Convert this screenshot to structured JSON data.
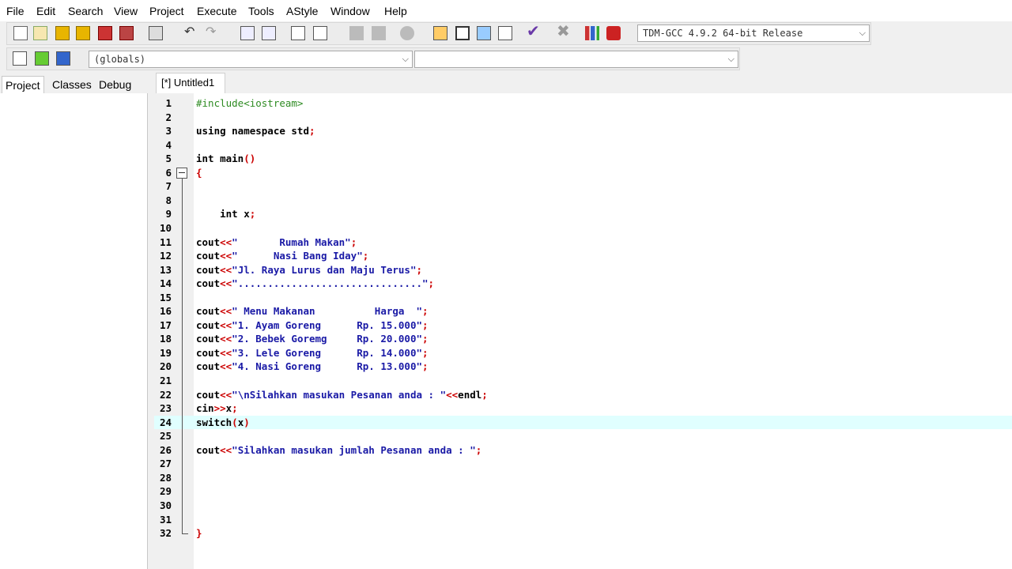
{
  "menu": [
    "File",
    "Edit",
    "Search",
    "View",
    "Project",
    "Execute",
    "Tools",
    "AStyle",
    "Window",
    "Help"
  ],
  "toolbar": {
    "compiler": "TDM-GCC 4.9.2 64-bit Release",
    "scope": "(globals)",
    "function": ""
  },
  "left_tabs": [
    "Project",
    "Classes",
    "Debug"
  ],
  "editor_tab": "[*] Untitled1",
  "colors": {
    "highlight_line": "#e0ffff",
    "string": "#1a1aa6",
    "symbol": "#cc0000",
    "preprocessor": "#2e8b22"
  },
  "code_lines": [
    {
      "n": "1",
      "parts": [
        [
          "pp",
          "#include<iostream>"
        ]
      ]
    },
    {
      "n": "2",
      "parts": []
    },
    {
      "n": "3",
      "parts": [
        [
          "kw",
          "using namespace std"
        ],
        [
          "sym",
          ";"
        ]
      ]
    },
    {
      "n": "4",
      "parts": []
    },
    {
      "n": "5",
      "parts": [
        [
          "kw",
          "int main"
        ],
        [
          "sym",
          "()"
        ]
      ]
    },
    {
      "n": "6",
      "parts": [
        [
          "sym",
          "{"
        ]
      ]
    },
    {
      "n": "7",
      "parts": []
    },
    {
      "n": "8",
      "parts": []
    },
    {
      "n": "9",
      "parts": [
        [
          "kw",
          "    int x"
        ],
        [
          "sym",
          ";"
        ]
      ]
    },
    {
      "n": "10",
      "parts": []
    },
    {
      "n": "11",
      "parts": [
        [
          "kw",
          "cout"
        ],
        [
          "sym",
          "<<"
        ],
        [
          "str",
          "\"       Rumah Makan\""
        ],
        [
          "sym",
          ";"
        ]
      ]
    },
    {
      "n": "12",
      "parts": [
        [
          "kw",
          "cout"
        ],
        [
          "sym",
          "<<"
        ],
        [
          "str",
          "\"      Nasi Bang Iday\""
        ],
        [
          "sym",
          ";"
        ]
      ]
    },
    {
      "n": "13",
      "parts": [
        [
          "kw",
          "cout"
        ],
        [
          "sym",
          "<<"
        ],
        [
          "str",
          "\"Jl. Raya Lurus dan Maju Terus\""
        ],
        [
          "sym",
          ";"
        ]
      ]
    },
    {
      "n": "14",
      "parts": [
        [
          "kw",
          "cout"
        ],
        [
          "sym",
          "<<"
        ],
        [
          "str",
          "\"...............................\""
        ],
        [
          "sym",
          ";"
        ]
      ]
    },
    {
      "n": "15",
      "parts": []
    },
    {
      "n": "16",
      "parts": [
        [
          "kw",
          "cout"
        ],
        [
          "sym",
          "<<"
        ],
        [
          "str",
          "\" Menu Makanan          Harga  \""
        ],
        [
          "sym",
          ";"
        ]
      ]
    },
    {
      "n": "17",
      "parts": [
        [
          "kw",
          "cout"
        ],
        [
          "sym",
          "<<"
        ],
        [
          "str",
          "\"1. Ayam Goreng      Rp. 15.000\""
        ],
        [
          "sym",
          ";"
        ]
      ]
    },
    {
      "n": "18",
      "parts": [
        [
          "kw",
          "cout"
        ],
        [
          "sym",
          "<<"
        ],
        [
          "str",
          "\"2. Bebek Goremg     Rp. 20.000\""
        ],
        [
          "sym",
          ";"
        ]
      ]
    },
    {
      "n": "19",
      "parts": [
        [
          "kw",
          "cout"
        ],
        [
          "sym",
          "<<"
        ],
        [
          "str",
          "\"3. Lele Goreng      Rp. 14.000\""
        ],
        [
          "sym",
          ";"
        ]
      ]
    },
    {
      "n": "20",
      "parts": [
        [
          "kw",
          "cout"
        ],
        [
          "sym",
          "<<"
        ],
        [
          "str",
          "\"4. Nasi Goreng      Rp. 13.000\""
        ],
        [
          "sym",
          ";"
        ]
      ]
    },
    {
      "n": "21",
      "parts": []
    },
    {
      "n": "22",
      "parts": [
        [
          "kw",
          "cout"
        ],
        [
          "sym",
          "<<"
        ],
        [
          "str",
          "\"\\nSilahkan masukan Pesanan anda : \""
        ],
        [
          "sym",
          "<<"
        ],
        [
          "kw",
          "endl"
        ],
        [
          "sym",
          ";"
        ]
      ]
    },
    {
      "n": "23",
      "parts": [
        [
          "kw",
          "cin"
        ],
        [
          "sym",
          ">>"
        ],
        [
          "kw",
          "x"
        ],
        [
          "sym",
          ";"
        ]
      ]
    },
    {
      "n": "24",
      "parts": [
        [
          "kw",
          "switch"
        ],
        [
          "sym",
          "("
        ],
        [
          "kw",
          "x"
        ],
        [
          "sym",
          ")"
        ]
      ]
    },
    {
      "n": "25",
      "parts": []
    },
    {
      "n": "26",
      "parts": [
        [
          "kw",
          "cout"
        ],
        [
          "sym",
          "<<"
        ],
        [
          "str",
          "\"Silahkan masukan jumlah Pesanan anda : \""
        ],
        [
          "sym",
          ";"
        ]
      ]
    },
    {
      "n": "27",
      "parts": []
    },
    {
      "n": "28",
      "parts": []
    },
    {
      "n": "29",
      "parts": []
    },
    {
      "n": "30",
      "parts": []
    },
    {
      "n": "31",
      "parts": []
    },
    {
      "n": "32",
      "parts": [
        [
          "sym",
          "}"
        ]
      ]
    }
  ]
}
